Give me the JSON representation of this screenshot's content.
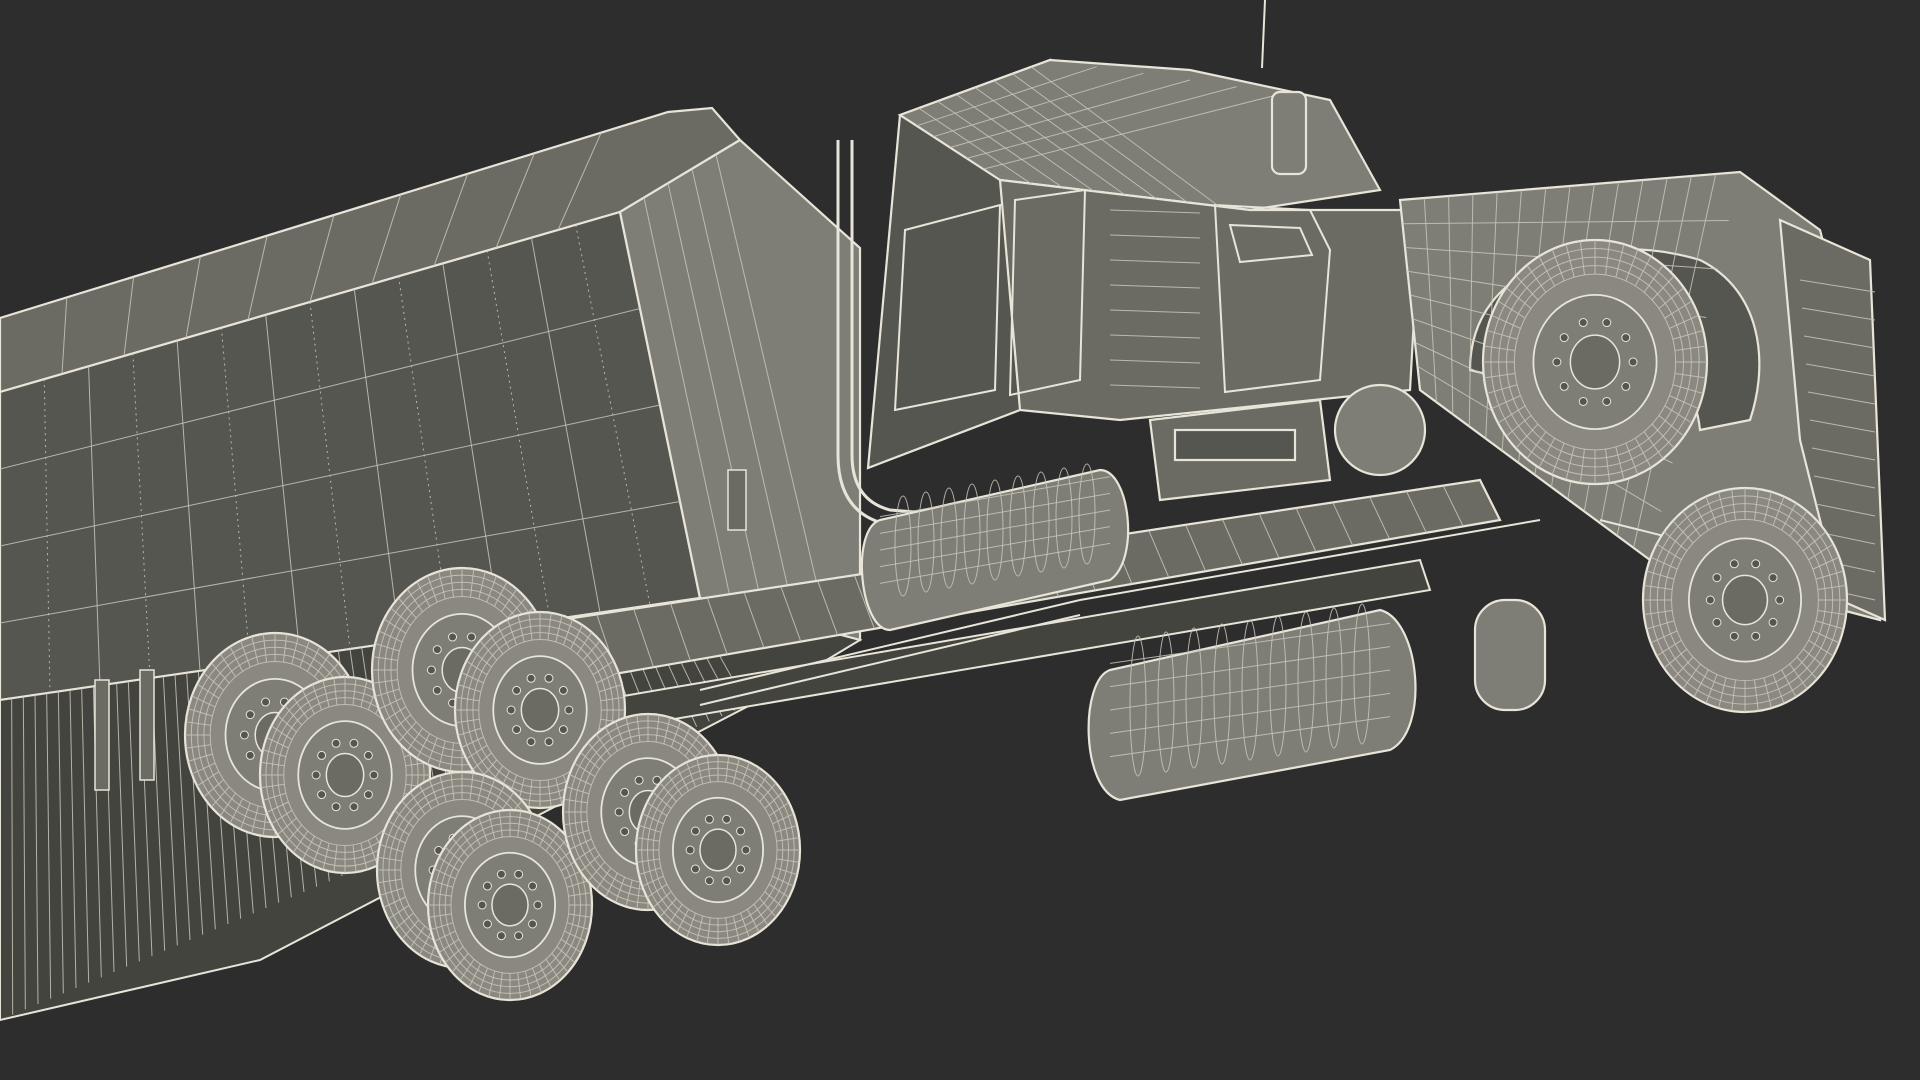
{
  "colors": {
    "background": "#2d2d2d",
    "panel_dark": "#565650",
    "panel_mid": "#6b6b64",
    "panel_light": "#7e7e76",
    "panel_shadow": "#44443f",
    "wire": "#e8e4d8",
    "wire_soft": "#c9c5b8",
    "tire_fill": "#8a8880"
  },
  "scene": {
    "subject": "semi-truck-with-box-trailer-wireframe",
    "parts": [
      "trailer-box",
      "trailer-side-skirt",
      "trailer-landing-gear",
      "cab",
      "cab-roof",
      "exhaust-stack",
      "sun-visor-light",
      "mirror",
      "hood",
      "front-wheel",
      "rear-steer-wheel",
      "fuel-tank",
      "battery-box",
      "air-tank",
      "chassis-rail",
      "drive-axle-wheels",
      "trailer-axle-wheels",
      "antenna"
    ]
  }
}
